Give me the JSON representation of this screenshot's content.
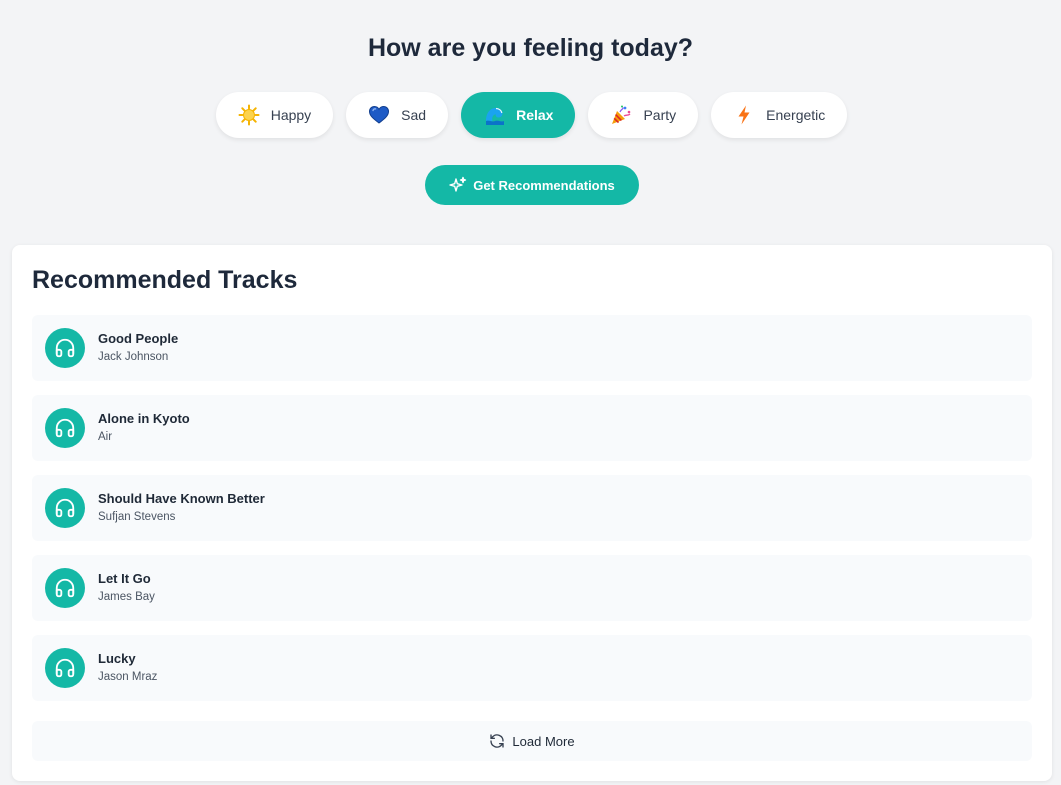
{
  "header": {
    "title": "How are you feeling today?"
  },
  "moods": [
    {
      "label": "Happy",
      "icon": "sun-icon",
      "selected": false
    },
    {
      "label": "Sad",
      "icon": "blue-heart-icon",
      "selected": false
    },
    {
      "label": "Relax",
      "icon": "wave-icon",
      "selected": true
    },
    {
      "label": "Party",
      "icon": "party-popper-icon",
      "selected": false
    },
    {
      "label": "Energetic",
      "icon": "lightning-icon",
      "selected": false
    }
  ],
  "cta": {
    "label": "Get Recommendations",
    "icon": "sparkles-icon"
  },
  "recommendations": {
    "title": "Recommended Tracks",
    "tracks": [
      {
        "name": "Good People",
        "artist": "Jack Johnson"
      },
      {
        "name": "Alone in Kyoto",
        "artist": "Air"
      },
      {
        "name": "Should Have Known Better",
        "artist": "Sufjan Stevens"
      },
      {
        "name": "Let It Go",
        "artist": "James Bay"
      },
      {
        "name": "Lucky",
        "artist": "Jason Mraz"
      }
    ],
    "load_more": "Load More"
  },
  "colors": {
    "accent": "#14b8a6",
    "background": "#f3f4f6",
    "card": "#ffffff",
    "row": "#f8fafc"
  }
}
